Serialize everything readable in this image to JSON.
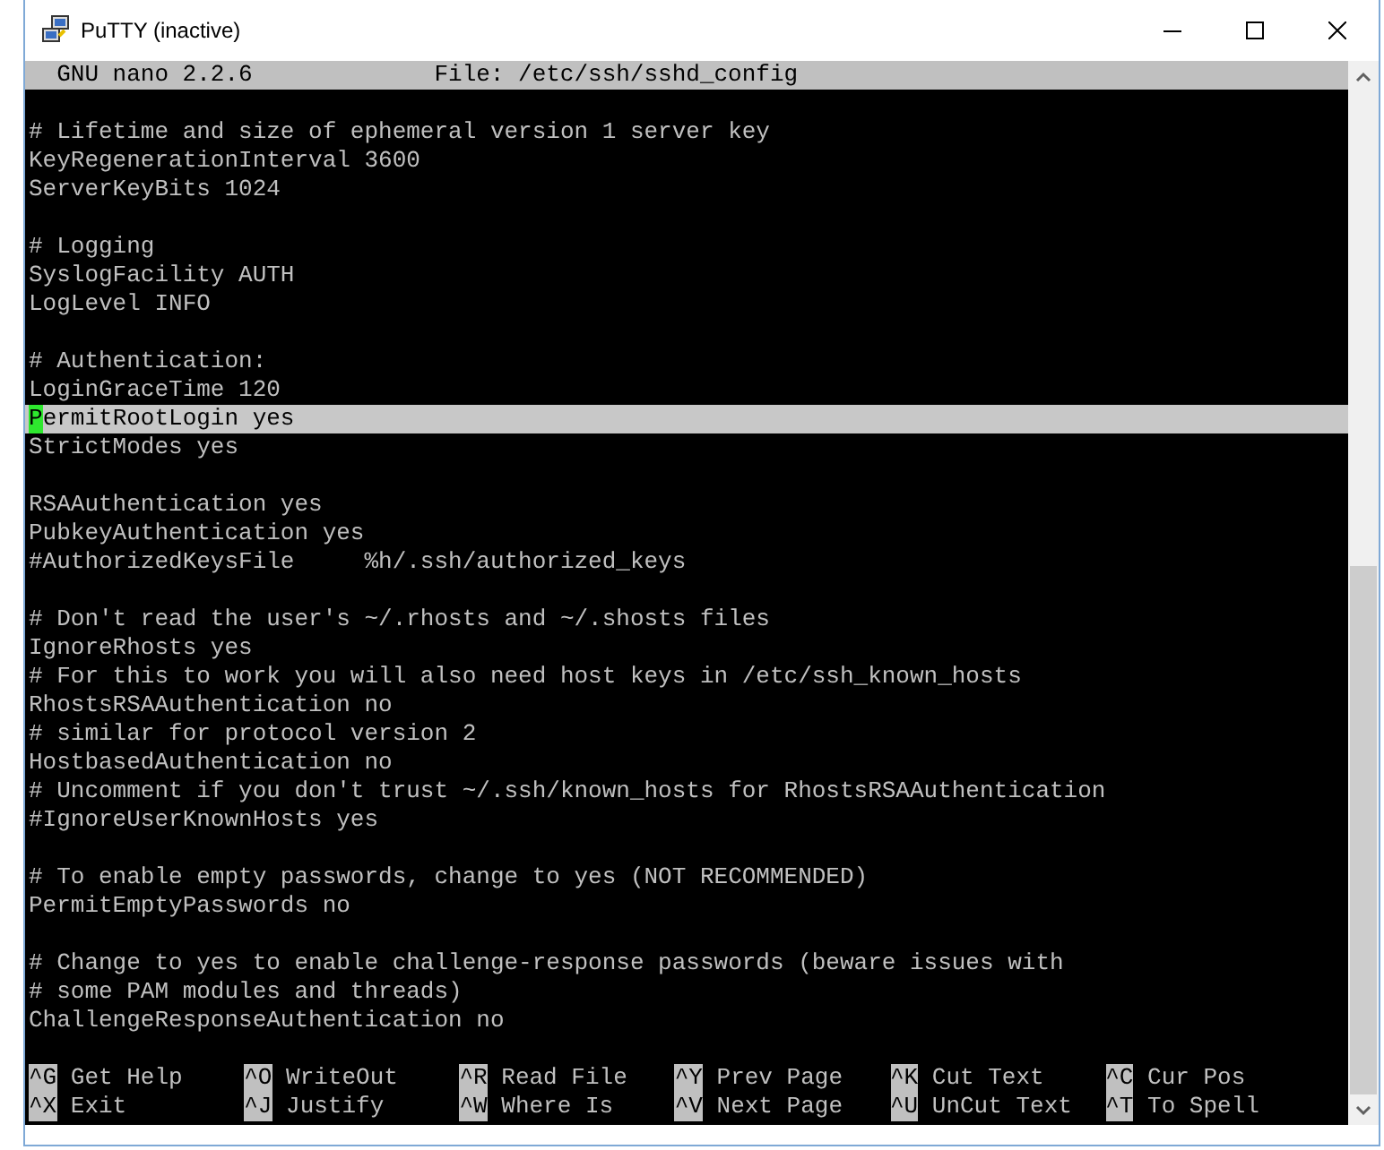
{
  "window": {
    "title": "PuTTY (inactive)"
  },
  "header": {
    "program": "GNU nano 2.2.6",
    "file": "File: /etc/ssh/sshd_config"
  },
  "lines": [
    {
      "kind": "blank"
    },
    {
      "kind": "text",
      "text": "# Lifetime and size of ephemeral version 1 server key",
      "highlighted": false,
      "cursor": false
    },
    {
      "kind": "text",
      "text": "KeyRegenerationInterval 3600",
      "highlighted": false,
      "cursor": false
    },
    {
      "kind": "text",
      "text": "ServerKeyBits 1024",
      "highlighted": false,
      "cursor": false
    },
    {
      "kind": "blank"
    },
    {
      "kind": "text",
      "text": "# Logging",
      "highlighted": false,
      "cursor": false
    },
    {
      "kind": "text",
      "text": "SyslogFacility AUTH",
      "highlighted": false,
      "cursor": false
    },
    {
      "kind": "text",
      "text": "LogLevel INFO",
      "highlighted": false,
      "cursor": false
    },
    {
      "kind": "blank"
    },
    {
      "kind": "text",
      "text": "# Authentication:",
      "highlighted": false,
      "cursor": false
    },
    {
      "kind": "text",
      "text": "LoginGraceTime 120",
      "highlighted": false,
      "cursor": false
    },
    {
      "kind": "text",
      "text": "PermitRootLogin yes",
      "highlighted": true,
      "cursor": true
    },
    {
      "kind": "text",
      "text": "StrictModes yes",
      "highlighted": false,
      "cursor": false
    },
    {
      "kind": "blank"
    },
    {
      "kind": "text",
      "text": "RSAAuthentication yes",
      "highlighted": false,
      "cursor": false
    },
    {
      "kind": "text",
      "text": "PubkeyAuthentication yes",
      "highlighted": false,
      "cursor": false
    },
    {
      "kind": "text",
      "text": "#AuthorizedKeysFile     %h/.ssh/authorized_keys",
      "highlighted": false,
      "cursor": false
    },
    {
      "kind": "blank"
    },
    {
      "kind": "text",
      "text": "# Don't read the user's ~/.rhosts and ~/.shosts files",
      "highlighted": false,
      "cursor": false
    },
    {
      "kind": "text",
      "text": "IgnoreRhosts yes",
      "highlighted": false,
      "cursor": false
    },
    {
      "kind": "text",
      "text": "# For this to work you will also need host keys in /etc/ssh_known_hosts",
      "highlighted": false,
      "cursor": false
    },
    {
      "kind": "text",
      "text": "RhostsRSAAuthentication no",
      "highlighted": false,
      "cursor": false
    },
    {
      "kind": "text",
      "text": "# similar for protocol version 2",
      "highlighted": false,
      "cursor": false
    },
    {
      "kind": "text",
      "text": "HostbasedAuthentication no",
      "highlighted": false,
      "cursor": false
    },
    {
      "kind": "text",
      "text": "# Uncomment if you don't trust ~/.ssh/known_hosts for RhostsRSAAuthentication",
      "highlighted": false,
      "cursor": false
    },
    {
      "kind": "text",
      "text": "#IgnoreUserKnownHosts yes",
      "highlighted": false,
      "cursor": false
    },
    {
      "kind": "blank"
    },
    {
      "kind": "text",
      "text": "# To enable empty passwords, change to yes (NOT RECOMMENDED)",
      "highlighted": false,
      "cursor": false
    },
    {
      "kind": "text",
      "text": "PermitEmptyPasswords no",
      "highlighted": false,
      "cursor": false
    },
    {
      "kind": "blank"
    },
    {
      "kind": "text",
      "text": "# Change to yes to enable challenge-response passwords (beware issues with",
      "highlighted": false,
      "cursor": false
    },
    {
      "kind": "text",
      "text": "# some PAM modules and threads)",
      "highlighted": false,
      "cursor": false
    },
    {
      "kind": "text",
      "text": "ChallengeResponseAuthentication no",
      "highlighted": false,
      "cursor": false
    },
    {
      "kind": "blank"
    }
  ],
  "shortcuts": [
    [
      {
        "key": "^G",
        "label": "Get Help"
      },
      {
        "key": "^O",
        "label": "WriteOut"
      },
      {
        "key": "^R",
        "label": "Read File"
      },
      {
        "key": "^Y",
        "label": "Prev Page"
      },
      {
        "key": "^K",
        "label": "Cut Text"
      },
      {
        "key": "^C",
        "label": "Cur Pos"
      }
    ],
    [
      {
        "key": "^X",
        "label": "Exit"
      },
      {
        "key": "^J",
        "label": "Justify"
      },
      {
        "key": "^W",
        "label": "Where Is"
      },
      {
        "key": "^V",
        "label": "Next Page"
      },
      {
        "key": "^U",
        "label": "UnCut Text"
      },
      {
        "key": "^T",
        "label": "To Spell"
      }
    ]
  ]
}
